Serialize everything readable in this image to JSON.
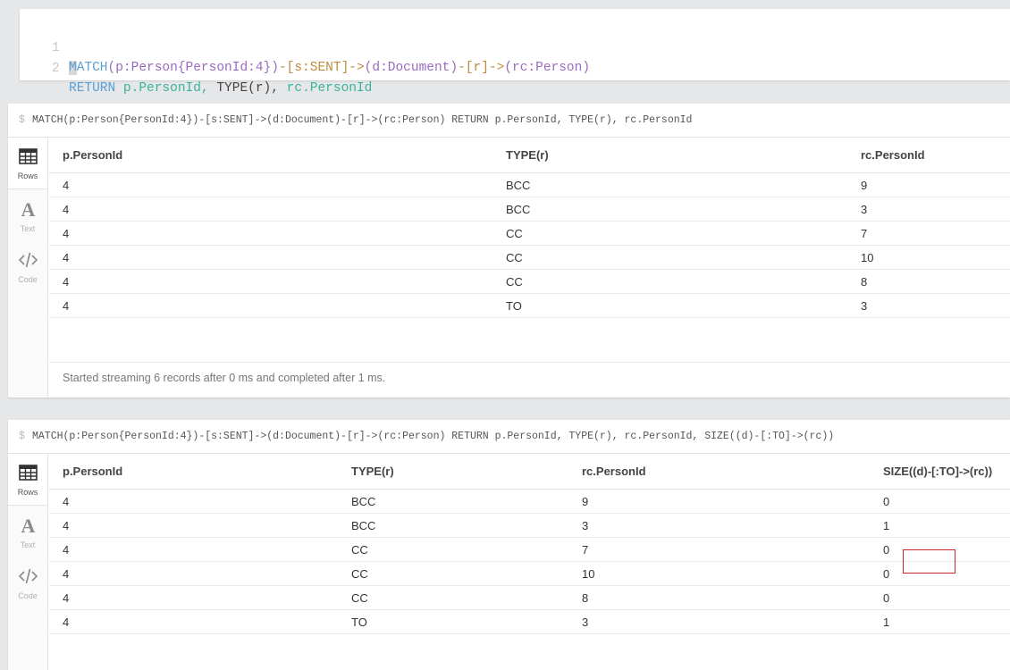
{
  "editor": {
    "lines": [
      {
        "number": "1"
      },
      {
        "number": "2"
      }
    ],
    "tokens": {
      "match_m": "M",
      "match_rest": "ATCH",
      "l1_a": "(p:Person{PersonId:4})",
      "l1_b": "-[s:SENT]->",
      "l1_c": "(d:Document)",
      "l1_d": "-[r]->",
      "l1_e": "(rc:Person)",
      "return_kw": "RETURN",
      "l2_a": "p.PersonId,",
      "l2_b": "TYPE(r),",
      "l2_c": "rc.PersonId"
    }
  },
  "frames": [
    {
      "prompt": "$",
      "query": "MATCH(p:Person{PersonId:4})-[s:SENT]->(d:Document)-[r]->(rc:Person) RETURN p.PersonId, TYPE(r), rc.PersonId",
      "sidebar": [
        {
          "label": "Rows",
          "icon": "table-icon",
          "active": true
        },
        {
          "label": "Text",
          "icon": "text-icon",
          "active": false
        },
        {
          "label": "Code",
          "icon": "code-icon",
          "active": false
        }
      ],
      "columns": [
        "p.PersonId",
        "TYPE(r)",
        "rc.PersonId"
      ],
      "rows": [
        [
          "4",
          "BCC",
          "9"
        ],
        [
          "4",
          "BCC",
          "3"
        ],
        [
          "4",
          "CC",
          "7"
        ],
        [
          "4",
          "CC",
          "10"
        ],
        [
          "4",
          "CC",
          "8"
        ],
        [
          "4",
          "TO",
          "3"
        ]
      ],
      "status": "Started streaming 6 records after 0 ms and completed after 1 ms."
    },
    {
      "prompt": "$",
      "query": "MATCH(p:Person{PersonId:4})-[s:SENT]->(d:Document)-[r]->(rc:Person) RETURN p.PersonId, TYPE(r), rc.PersonId, SIZE((d)-[:TO]->(rc))",
      "sidebar": [
        {
          "label": "Rows",
          "icon": "table-icon",
          "active": true
        },
        {
          "label": "Text",
          "icon": "text-icon",
          "active": false
        },
        {
          "label": "Code",
          "icon": "code-icon",
          "active": false
        }
      ],
      "columns": [
        "p.PersonId",
        "TYPE(r)",
        "rc.PersonId",
        "SIZE((d)-[:TO]->(rc))"
      ],
      "rows": [
        [
          "4",
          "BCC",
          "9",
          "0"
        ],
        [
          "4",
          "BCC",
          "3",
          "1"
        ],
        [
          "4",
          "CC",
          "7",
          "0"
        ],
        [
          "4",
          "CC",
          "10",
          "0"
        ],
        [
          "4",
          "CC",
          "8",
          "0"
        ],
        [
          "4",
          "TO",
          "3",
          "1"
        ]
      ],
      "highlight": {
        "row": 1,
        "column": 3,
        "color": "#c62828"
      }
    }
  ]
}
